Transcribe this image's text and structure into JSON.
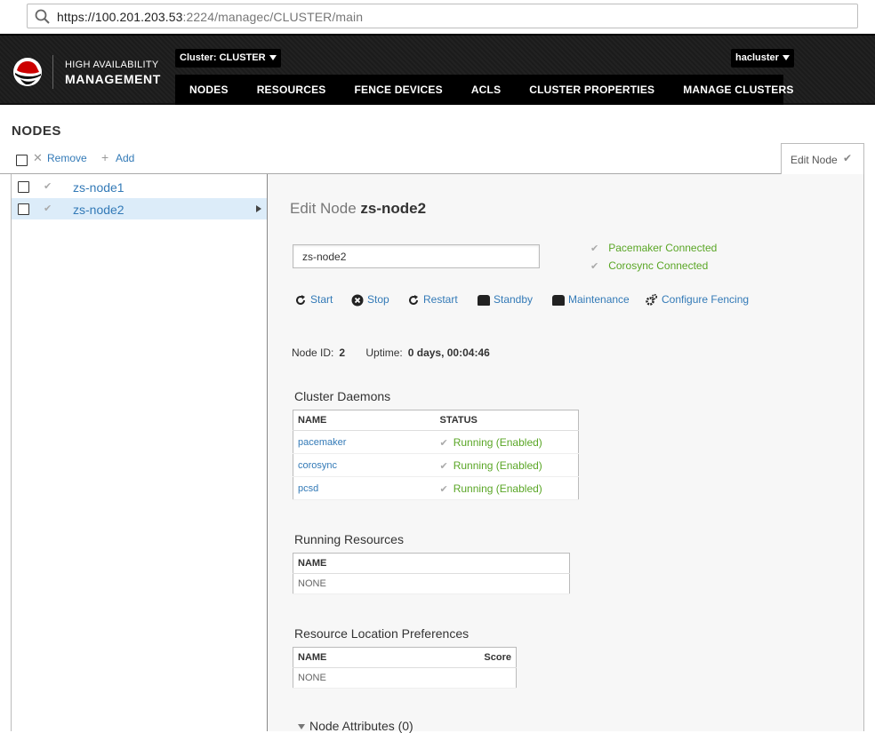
{
  "browser": {
    "url_main": "https://100.201.203.53",
    "url_rest": ":2224/managec/CLUSTER/main"
  },
  "header": {
    "logo_line1": "HIGH AVAILABILITY",
    "logo_line2": "MANAGEMENT",
    "cluster_dropdown": "Cluster: CLUSTER",
    "user_dropdown": "hacluster",
    "nav": [
      "NODES",
      "RESOURCES",
      "FENCE DEVICES",
      "ACLS",
      "CLUSTER PROPERTIES",
      "MANAGE CLUSTERS"
    ]
  },
  "page": {
    "title": "NODES",
    "toolbar": {
      "remove_label": "Remove",
      "add_label": "Add"
    },
    "tab_label": "Edit Node"
  },
  "nodes": [
    {
      "name": "zs-node1",
      "selected": false
    },
    {
      "name": "zs-node2",
      "selected": true
    }
  ],
  "edit": {
    "title_prefix": "Edit Node",
    "node_name": "zs-node2",
    "input_value": "zs-node2",
    "status": [
      "Pacemaker Connected",
      "Corosync Connected"
    ],
    "actions": {
      "start": "Start",
      "stop": "Stop",
      "restart": "Restart",
      "standby": "Standby",
      "maintenance": "Maintenance",
      "configure_fencing": "Configure Fencing"
    },
    "node_id_label": "Node ID:",
    "node_id": "2",
    "uptime_label": "Uptime:",
    "uptime": "0 days, 00:04:46"
  },
  "daemons": {
    "title": "Cluster Daemons",
    "headers": [
      "NAME",
      "STATUS"
    ],
    "rows": [
      {
        "name": "pacemaker",
        "status": "Running (Enabled)"
      },
      {
        "name": "corosync",
        "status": "Running (Enabled)"
      },
      {
        "name": "pcsd",
        "status": "Running (Enabled)"
      }
    ]
  },
  "running_resources": {
    "title": "Running Resources",
    "header": "NAME",
    "empty": "NONE"
  },
  "location_prefs": {
    "title": "Resource Location Preferences",
    "header_name": "NAME",
    "header_score": "Score",
    "empty": "NONE"
  },
  "node_attributes": {
    "label": "Node Attributes (0)"
  },
  "colors": {
    "link": "#337ab7",
    "status_ok": "#5aa626",
    "header_bg": "#1f1f1f",
    "selected_row": "#dcecf9",
    "logo_red": "#cc0000"
  },
  "icons": [
    "search-icon",
    "redhat-logo",
    "check-icon",
    "refresh-icon",
    "stop-icon",
    "standby-icon",
    "maintenance-icon",
    "gear-icon"
  ]
}
